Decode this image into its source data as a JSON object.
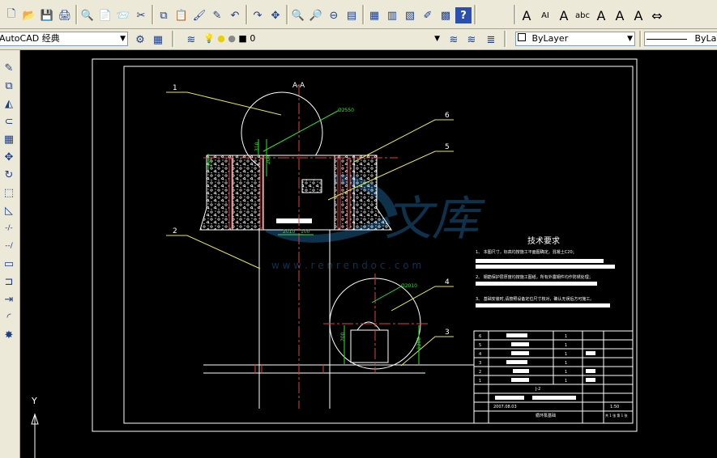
{
  "toolbar_standard": {
    "icons": [
      "new-icon",
      "open-icon",
      "save-icon",
      "print-icon",
      "plot-preview-icon",
      "publish-icon",
      "etransmit-icon",
      "cut-icon",
      "copy-icon",
      "paste-icon",
      "matchprop-icon",
      "blockedit-icon",
      "undo-icon",
      "redo-icon",
      "pan-icon",
      "zoom-realtime-icon",
      "zoom-window-icon",
      "zoom-previous-icon",
      "properties-icon",
      "design-center-icon",
      "tool-palettes-icon",
      "sheetset-icon",
      "markup-icon",
      "calculator-icon",
      "help-icon"
    ],
    "text_icons": [
      {
        "name": "multiline-text-icon",
        "glyph": "A"
      },
      {
        "name": "text-style-icon",
        "glyph": "AI"
      },
      {
        "name": "edit-text-icon",
        "glyph": "A"
      },
      {
        "name": "spell-check-icon",
        "glyph": "abc"
      },
      {
        "name": "find-text-icon",
        "glyph": "A"
      },
      {
        "name": "scale-text-icon",
        "glyph": "A"
      },
      {
        "name": "justify-text-icon",
        "glyph": "A"
      },
      {
        "name": "convert-distance-icon",
        "glyph": "⇔"
      }
    ]
  },
  "workspace": {
    "value": "AutoCAD 经典"
  },
  "layer": {
    "value": "0"
  },
  "color": {
    "value": "ByLayer"
  },
  "linetype": {
    "value": "ByLa"
  },
  "left_tools": [
    "line-icon",
    "copy-icon",
    "mirror-icon",
    "offset-icon",
    "array-icon",
    "move-icon",
    "rotate-icon",
    "scale-icon",
    "stretch-icon",
    "trim-icon",
    "extend-icon",
    "break-icon",
    "join-icon",
    "chamfer-icon",
    "fillet-icon",
    "explode-icon"
  ],
  "drawing": {
    "section_title": "A-A",
    "callouts": [
      "1",
      "2",
      "3",
      "4",
      "5",
      "6"
    ],
    "dims": {
      "dia_top": "Ø2550",
      "dia_bottom": "Ø2010",
      "h_310": "310",
      "h_204": "204",
      "h_250": "250",
      "w_2010": "2010",
      "w_100": "100",
      "h_200": "200",
      "h_1200": "1200",
      "h_88": "88"
    },
    "tech_title": "技术要求",
    "tech_lines": [
      "1、  本图尺寸，标高均按施工平面图确定，混凝土C20；",
      "2、  钢筋保护层厚度均按施工图纸，所有外露钢件均作防锈处理；",
      "3、  基础安装时,请按照设备定位尺寸核对，确认无误后方可施工。"
    ],
    "title_block": {
      "rows": [
        [
          "6",
          "",
          "1",
          ""
        ],
        [
          "5",
          "",
          "1",
          ""
        ],
        [
          "4",
          "",
          "1",
          ""
        ],
        [
          "3",
          "",
          "1",
          ""
        ],
        [
          "2",
          "",
          "1",
          ""
        ],
        [
          "1",
          "",
          "1",
          ""
        ]
      ],
      "drawing_no": "J-2",
      "date": "2007.08.03",
      "name": "循环泵基础",
      "scale": "1:50",
      "sheet": "共 1 张  第 1 张"
    }
  },
  "watermark": {
    "site": "w w w . r e n r e n d o c . c o m",
    "brand": "文库"
  },
  "ucs": {
    "y_label": "Y"
  }
}
